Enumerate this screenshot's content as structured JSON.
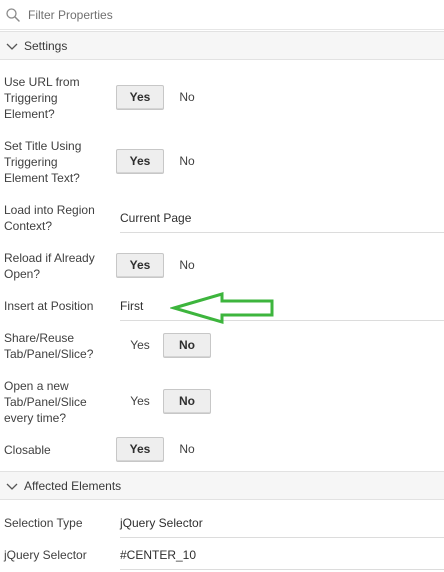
{
  "filter": {
    "placeholder": "Filter Properties",
    "icon": "search-icon"
  },
  "sections": [
    {
      "title": "Settings",
      "icon": "chevron-down-icon"
    },
    {
      "title": "Affected Elements",
      "icon": "chevron-down-icon"
    }
  ],
  "settings": {
    "use_url": {
      "label": "Use URL from Triggering Element?",
      "yes": "Yes",
      "no": "No",
      "selected": "Yes"
    },
    "set_title": {
      "label": "Set Title Using Triggering Element Text?",
      "yes": "Yes",
      "no": "No",
      "selected": "Yes"
    },
    "load_region": {
      "label": "Load into Region Context?",
      "value": "Current Page"
    },
    "reload_open": {
      "label": "Reload if Already Open?",
      "yes": "Yes",
      "no": "No",
      "selected": "Yes"
    },
    "insert_position": {
      "label": "Insert at Position",
      "value": "First"
    },
    "share_reuse": {
      "label": "Share/Reuse Tab/Panel/Slice?",
      "yes": "Yes",
      "no": "No",
      "selected": "No"
    },
    "open_new": {
      "label": "Open a new Tab/Panel/Slice every time?",
      "yes": "Yes",
      "no": "No",
      "selected": "No"
    },
    "closable": {
      "label": "Closable",
      "yes": "Yes",
      "no": "No",
      "selected": "Yes"
    }
  },
  "affected": {
    "selection_type": {
      "label": "Selection Type",
      "value": "jQuery Selector"
    },
    "jquery_selector": {
      "label": "jQuery Selector",
      "value": "#CENTER_10"
    }
  },
  "colors": {
    "annotation_arrow": "#3db53d",
    "selected_bg": "#eeeeee"
  }
}
